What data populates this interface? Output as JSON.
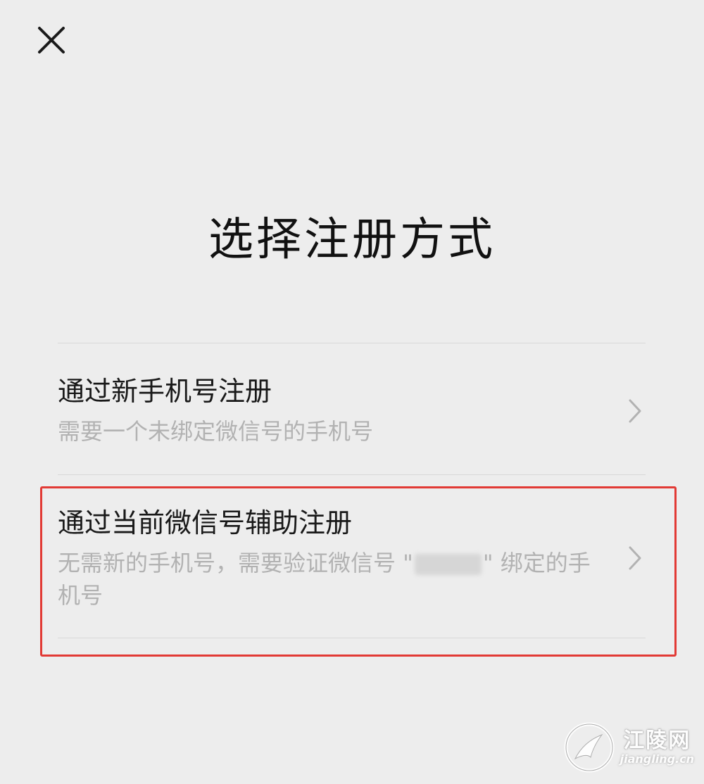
{
  "header": {
    "close_icon": "close-icon"
  },
  "page": {
    "title": "选择注册方式"
  },
  "options": [
    {
      "title": "通过新手机号注册",
      "description": "需要一个未绑定微信号的手机号",
      "icon": "chevron-right-icon"
    },
    {
      "title": "通过当前微信号辅助注册",
      "description_before": "无需新的手机号，需要验证微信号 \"",
      "description_after": "\" 绑定的手机号",
      "icon": "chevron-right-icon",
      "highlighted": true
    }
  ],
  "colors": {
    "background": "#ededed",
    "title_text": "#111111",
    "desc_text": "#b2b2b2",
    "highlight_border": "#e23a35"
  },
  "watermark": {
    "cn": "江陵网",
    "en": "jiangling.cn"
  }
}
